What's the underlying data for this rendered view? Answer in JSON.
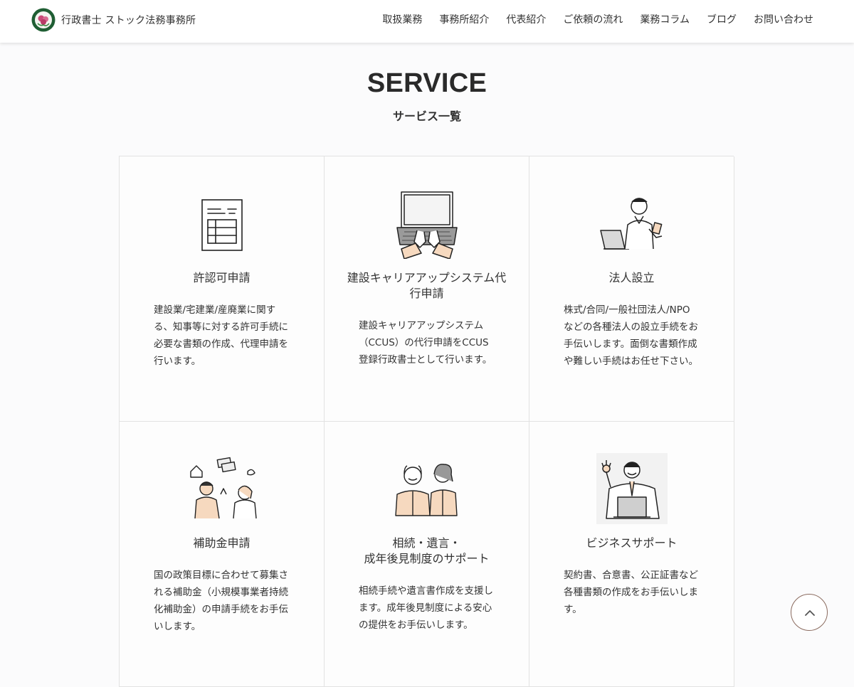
{
  "header": {
    "logo_text": "行政書士 ストック法務事務所",
    "nav": [
      "取扱業務",
      "事務所紹介",
      "代表紹介",
      "ご依頼の流れ",
      "業務コラム",
      "ブログ",
      "お問い合わせ"
    ]
  },
  "section": {
    "title": "SERVICE",
    "subtitle": "サービス一覧"
  },
  "services": [
    {
      "icon": "document-form-icon",
      "title": "許認可申請",
      "desc": "建設業/宅建業/産廃業に関する、知事等に対する許可手続に必要な書類の作成、代理申請を行います。"
    },
    {
      "icon": "laptop-typing-icon",
      "title": "建設キャリアアップシステム代行申請",
      "desc": "建設キャリアアップシステム（CCUS）の代行申請をCCUS登録行政書士として行います。"
    },
    {
      "icon": "person-with-laptop-icon",
      "title": "法人設立",
      "desc": "株式/合同/一般社団法人/NPOなどの各種法人の設立手続をお手伝いします。面倒な書類作成や難しい手続はお任せ下さい。"
    },
    {
      "icon": "couple-subsidy-icon",
      "title": "補助金申請",
      "desc": "国の政策目標に合わせて募集される補助金（小規模事業者持続化補助金）の申請手続をお手伝いします。"
    },
    {
      "icon": "elderly-couple-icon",
      "title": "相続・遺言・\n成年後見制度のサポート",
      "desc": "相続手続や遺言書作成を支援します。成年後見制度による安心の提供をお手伝いします。"
    },
    {
      "icon": "businessman-ok-icon",
      "title": "ビジネスサポート",
      "desc": "契約書、合意書、公正証書など各種書類の作成をお手伝いします。"
    }
  ],
  "colors": {
    "accent_skin": "#f6d9bf",
    "grid_border": "#e2e2e2",
    "to_top_border": "#8a6a5e"
  }
}
